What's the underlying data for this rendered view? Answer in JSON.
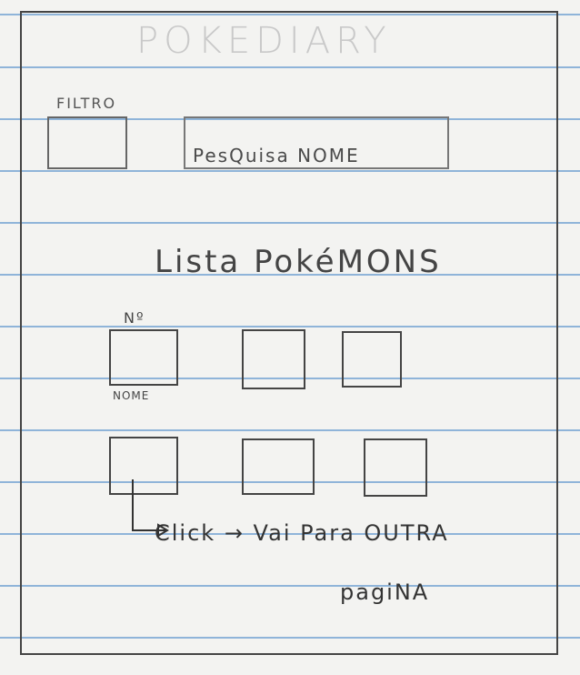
{
  "app": {
    "title": "POKEDIARY"
  },
  "filter": {
    "label": "FILTRO"
  },
  "search": {
    "placeholder": "PesQuisa NOME"
  },
  "list": {
    "title": "Lista PokéMONS",
    "card_number_label": "Nº",
    "card_name_label": "NOME"
  },
  "annotation": {
    "line1": "Click → Vai Para OUTRA",
    "line2": "pagiNA"
  }
}
